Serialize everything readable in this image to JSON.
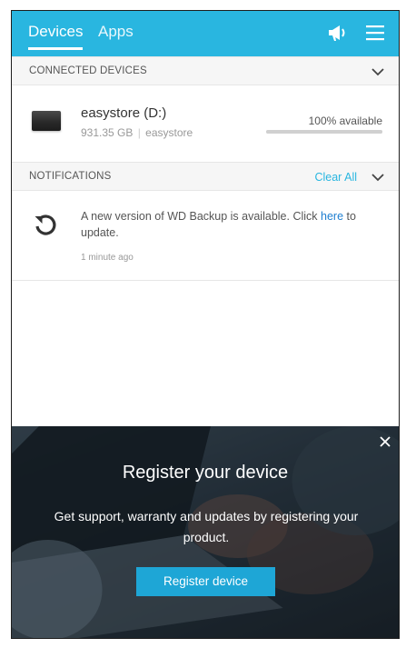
{
  "header": {
    "tabs": [
      {
        "label": "Devices",
        "active": true
      },
      {
        "label": "Apps",
        "active": false
      }
    ],
    "icons": [
      "megaphone-icon",
      "hamburger-menu-icon"
    ]
  },
  "connected_devices": {
    "title": "CONNECTED DEVICES",
    "items": [
      {
        "name": "easystore (D:)",
        "size": "931.35 GB",
        "model": "easystore",
        "availability": "100% available",
        "available_fraction": 1.0
      }
    ]
  },
  "notifications": {
    "title": "NOTIFICATIONS",
    "clear_all": "Clear All",
    "items": [
      {
        "text_before": "A new version of WD Backup is available. Click ",
        "link": "here",
        "text_after": " to update.",
        "time": "1 minute ago"
      }
    ]
  },
  "banner": {
    "title": "Register your device",
    "text": "Get support, warranty and updates by registering your product.",
    "button": "Register device"
  },
  "colors": {
    "accent": "#29b6e0",
    "link": "#1f7fd1",
    "button": "#1ea6d6"
  }
}
